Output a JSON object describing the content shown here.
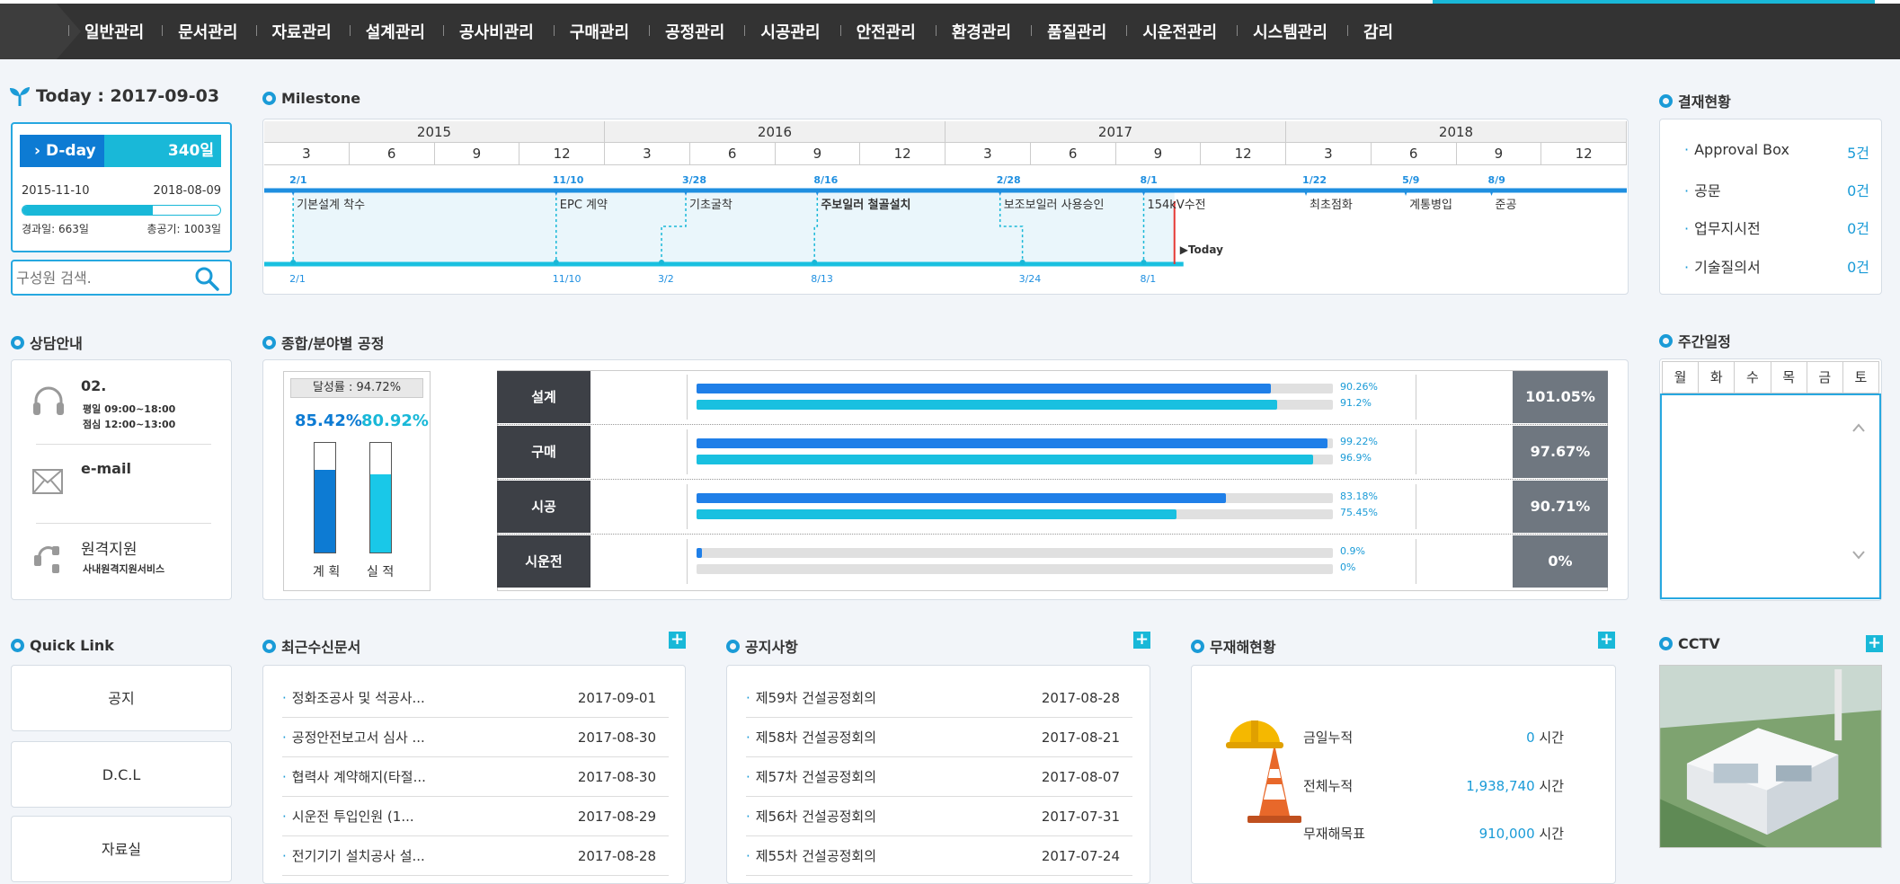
{
  "nav": {
    "items": [
      "일반관리",
      "문서관리",
      "자료관리",
      "설계관리",
      "공사비관리",
      "구매관리",
      "공정관리",
      "시공관리",
      "안전관리",
      "환경관리",
      "품질관리",
      "시운전관리",
      "시스템관리",
      "감리"
    ]
  },
  "today": {
    "label": "Today : 2017-09-03"
  },
  "dday": {
    "label": "D-day",
    "value": "340일",
    "start": "2015-11-10",
    "end": "2018-08-09",
    "elapsed": "경과일: 663일",
    "total": "총공기: 1003일",
    "progress": 0.661
  },
  "search": {
    "placeholder": "구성원 검색."
  },
  "milestone": {
    "title": "Milestone",
    "years": [
      "2015",
      "2016",
      "2017",
      "2018"
    ],
    "months": [
      "3",
      "6",
      "9",
      "12",
      "3",
      "6",
      "9",
      "12",
      "3",
      "6",
      "9",
      "12",
      "3",
      "6",
      "9",
      "12"
    ],
    "plan_events": [
      {
        "date": "2/1",
        "label": "기본설계 착수"
      },
      {
        "date": "11/10",
        "label": "EPC 계약"
      },
      {
        "date": "3/28",
        "label": "기초굴착"
      },
      {
        "date": "8/16",
        "label": "주보일러 철골설치"
      },
      {
        "date": "2/28",
        "label": "보조보일러 사용승인"
      },
      {
        "date": "8/1",
        "label": "154kV수전"
      },
      {
        "date": "1/22",
        "label": "최초점화"
      },
      {
        "date": "5/9",
        "label": "계통병입"
      },
      {
        "date": "8/9",
        "label": "준공"
      }
    ],
    "actual_dates": [
      "2/1",
      "11/10",
      "3/2",
      "8/13",
      "3/24",
      "8/1"
    ],
    "today_label": "▶Today"
  },
  "approval": {
    "title": "결재현황",
    "items": [
      {
        "label": "Approval Box",
        "count": "5건"
      },
      {
        "label": "공문",
        "count": "0건"
      },
      {
        "label": "업무지시전",
        "count": "0건"
      },
      {
        "label": "기술질의서",
        "count": "0건"
      }
    ]
  },
  "counsel": {
    "title": "상담안내",
    "phone": "02.",
    "hours1": "평일 09:00~18:00",
    "hours2": "점심 12:00~13:00",
    "email": "e-mail",
    "remote": "원격지원",
    "remote_sub": "사내원격지원서비스"
  },
  "process": {
    "title": "종합/분야별 공정",
    "achievement": "달성률 : 94.72%",
    "plan_pct": "85.42%",
    "actual_pct": "80.92%",
    "plan_value": 85.42,
    "actual_value": 80.92,
    "plan_label": "계 획",
    "actual_label": "실 적",
    "rows": [
      {
        "name": "설계",
        "plan": 90.26,
        "actual": 91.2,
        "plan_text": "90.26%",
        "actual_text": "91.2%",
        "total": "101.05%"
      },
      {
        "name": "구매",
        "plan": 99.22,
        "actual": 96.9,
        "plan_text": "99.22%",
        "actual_text": "96.9%",
        "total": "97.67%"
      },
      {
        "name": "시공",
        "plan": 83.18,
        "actual": 75.45,
        "plan_text": "83.18%",
        "actual_text": "75.45%",
        "total": "90.71%"
      },
      {
        "name": "시운전",
        "plan": 0.9,
        "actual": 0,
        "plan_text": "0.9%",
        "actual_text": "0%",
        "total": "0%"
      }
    ]
  },
  "weekly": {
    "title": "주간일정",
    "days": [
      "월",
      "화",
      "수",
      "목",
      "금",
      "토"
    ]
  },
  "quick_link": {
    "title": "Quick Link",
    "items": [
      "공지",
      "D.C.L",
      "자료실"
    ]
  },
  "recent_docs": {
    "title": "최근수신문서",
    "rows": [
      {
        "title": "정화조공사 및 석공사...",
        "date": "2017-09-01"
      },
      {
        "title": "공정안전보고서 심사 ...",
        "date": "2017-08-30"
      },
      {
        "title": "협력사 계약해지(타절...",
        "date": "2017-08-30"
      },
      {
        "title": "시운전 투입인원 (1...",
        "date": "2017-08-29"
      },
      {
        "title": "전기기기 설치공사 설...",
        "date": "2017-08-28"
      }
    ]
  },
  "notices": {
    "title": "공지사항",
    "rows": [
      {
        "title": "제59차 건설공정회의",
        "date": "2017-08-28"
      },
      {
        "title": "제58차 건설공정회의",
        "date": "2017-08-21"
      },
      {
        "title": "제57차 건설공정회의",
        "date": "2017-08-07"
      },
      {
        "title": "제56차 건설공정회의",
        "date": "2017-07-31"
      },
      {
        "title": "제55차 건설공정회의",
        "date": "2017-07-24"
      }
    ]
  },
  "safety": {
    "title": "무재해현황",
    "rows": [
      {
        "label": "금일누적",
        "value": "0",
        "unit": "시간"
      },
      {
        "label": "전체누적",
        "value": "1,938,740",
        "unit": "시간"
      },
      {
        "label": "무재해목표",
        "value": "910,000",
        "unit": "시간"
      }
    ]
  },
  "cctv": {
    "title": "CCTV"
  },
  "colors": {
    "accent": "#19b8d8",
    "primary": "#0d7bd3",
    "nav": "#333333",
    "today_line": "#e53935"
  }
}
